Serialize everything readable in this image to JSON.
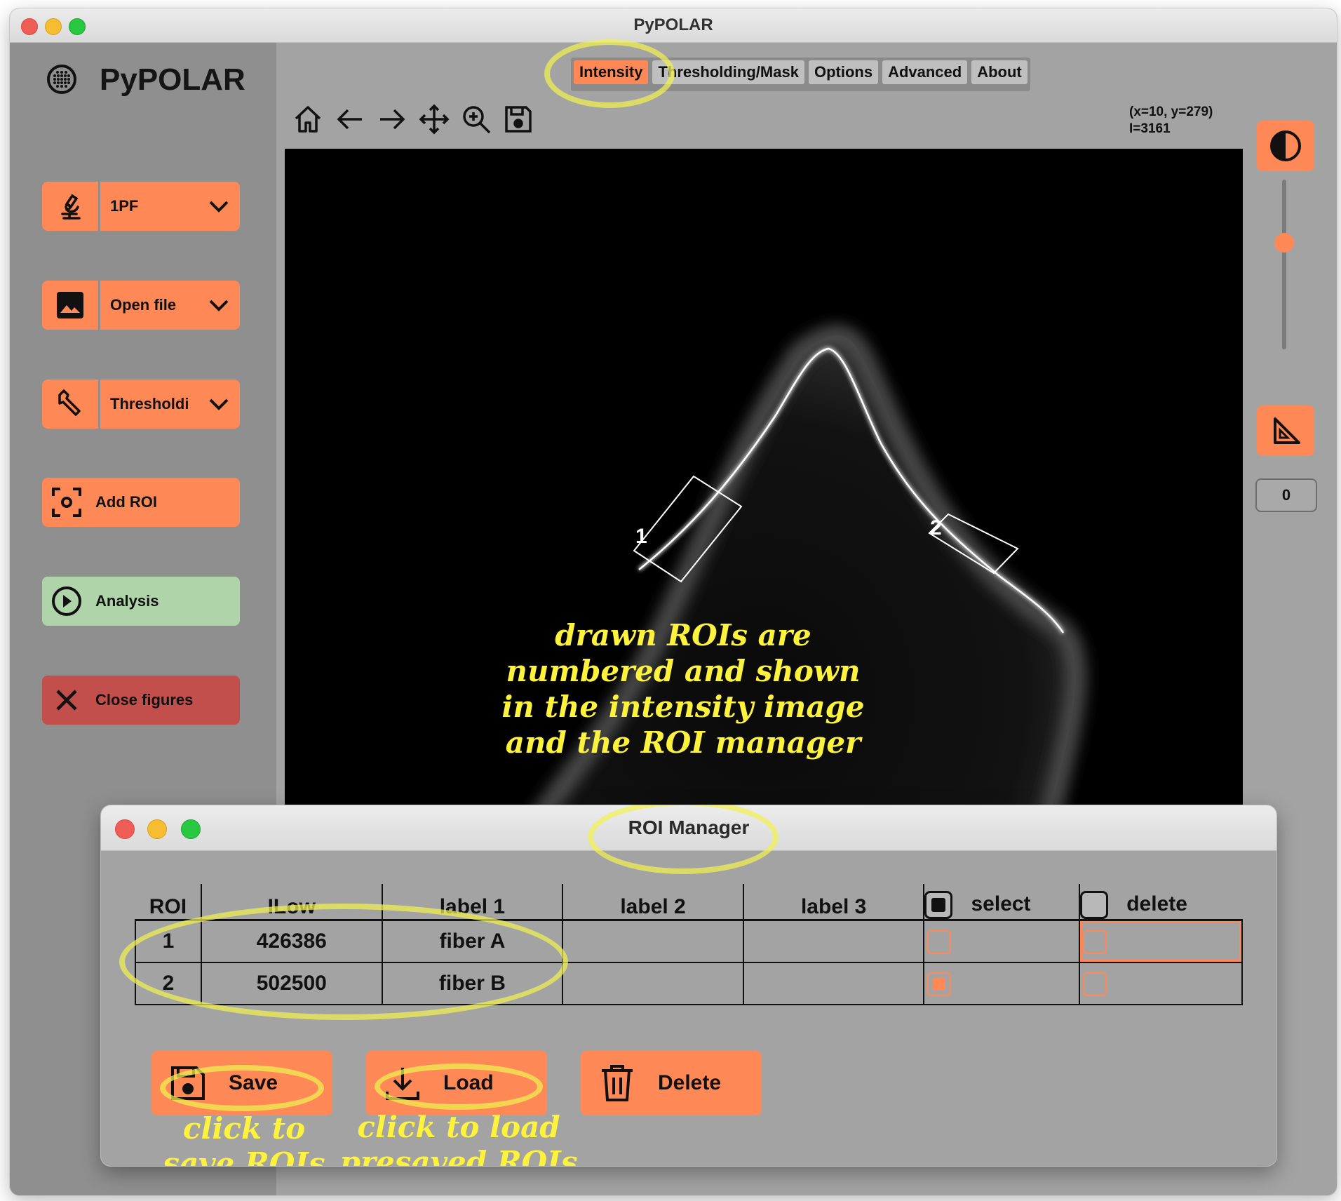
{
  "window": {
    "title": "PyPOLAR"
  },
  "sidebar": {
    "logo_text": "PyPOLAR",
    "items": [
      {
        "label": "1PF",
        "icon": "microscope-icon",
        "has_dropdown": true
      },
      {
        "label": "Open file",
        "icon": "image-icon",
        "has_dropdown": true
      },
      {
        "label": "Thresholdi",
        "icon": "wrench-icon",
        "has_dropdown": true
      },
      {
        "label": "Add ROI",
        "icon": "roi-target-icon"
      },
      {
        "label": "Analysis",
        "icon": "play-circle-icon"
      },
      {
        "label": "Close figures",
        "icon": "close-icon"
      }
    ]
  },
  "tabs": [
    {
      "label": "Intensity",
      "active": true
    },
    {
      "label": "Thresholding/Mask",
      "active": false
    },
    {
      "label": "Options",
      "active": false
    },
    {
      "label": "Advanced",
      "active": false
    },
    {
      "label": "About",
      "active": false
    }
  ],
  "toolbar": [
    "home-icon",
    "back-arrow-icon",
    "forward-arrow-icon",
    "pan-icon",
    "zoom-icon",
    "save-icon"
  ],
  "coords": {
    "line1": "(x=10, y=279)",
    "line2": "I=3161"
  },
  "right_panel": {
    "contrast_icon": "contrast-icon",
    "ruler_icon": "set-square-icon",
    "counter_value": "0"
  },
  "image": {
    "roi_labels": [
      "1",
      "2"
    ]
  },
  "annotations": {
    "image_note": "drawn ROIs are\nnumbered and shown\nin the intensity image\nand the ROI manager",
    "save_note": "click to\nsave ROIs",
    "load_note": "click to load\npresaved ROIs"
  },
  "roi_manager": {
    "title": "ROI Manager",
    "columns": [
      "ROI",
      "ILow",
      "label 1",
      "label 2",
      "label 3",
      "select",
      "delete"
    ],
    "header_select_checked": true,
    "header_delete_checked": false,
    "rows": [
      {
        "roi": "1",
        "ilow": "426386",
        "label1": "fiber A",
        "label2": "",
        "label3": "",
        "select": false,
        "delete": false
      },
      {
        "roi": "2",
        "ilow": "502500",
        "label1": "fiber B",
        "label2": "",
        "label3": "",
        "select": true,
        "delete": false
      }
    ],
    "buttons": {
      "save": "Save",
      "load": "Load",
      "delete": "Delete"
    }
  },
  "colors": {
    "accent": "#ff8956",
    "analysis": "#b0d4a9",
    "close": "#c24f4b",
    "highlight": "#f0f250",
    "annotation": "#fdf23c"
  }
}
